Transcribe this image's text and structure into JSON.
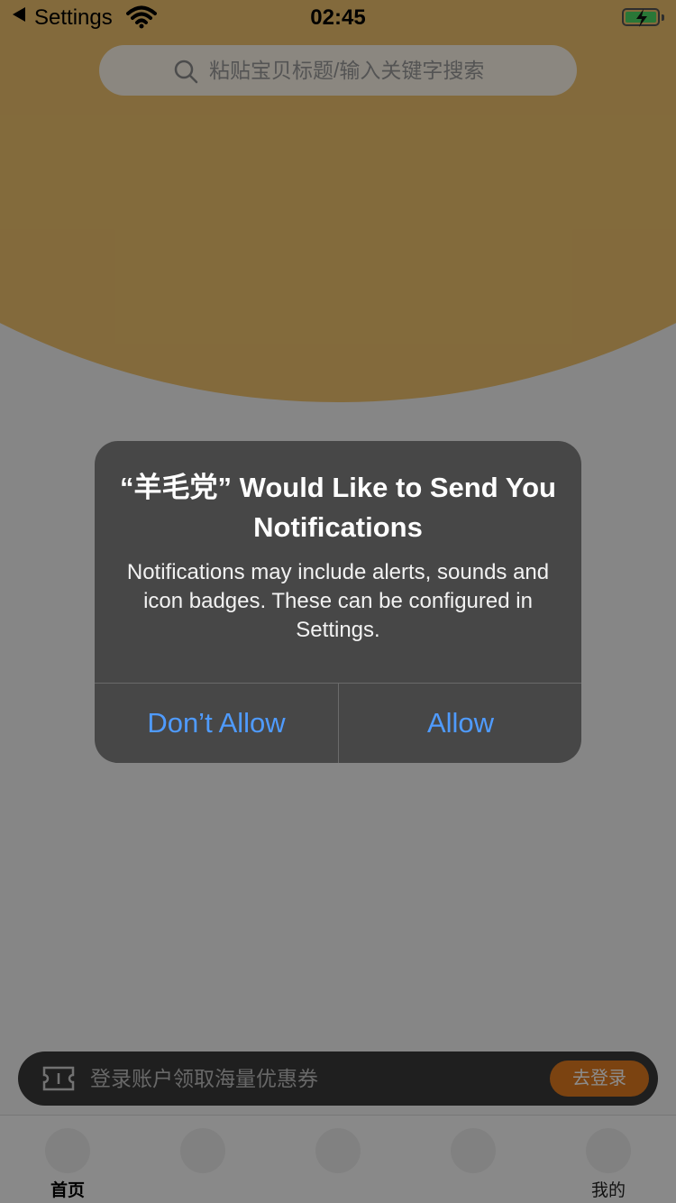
{
  "status_bar": {
    "back_app": "Settings",
    "time": "02:45"
  },
  "search": {
    "placeholder": "粘贴宝贝标题/输入关键字搜索"
  },
  "login_banner": {
    "text": "登录账户领取海量优惠券",
    "button_label": "去登录"
  },
  "tabs": [
    {
      "label": "首页",
      "active": true
    },
    {
      "label": ""
    },
    {
      "label": ""
    },
    {
      "label": ""
    },
    {
      "label": "我的"
    }
  ],
  "alert": {
    "title": "“羊毛党” Would Like to Send You Notifications",
    "message": "Notifications may include alerts, sounds and icon badges. These can be configured in Settings.",
    "buttons": {
      "dont_allow": "Don’t Allow",
      "allow": "Allow"
    }
  },
  "colors": {
    "hero": "#efc26e",
    "accent_button": "#e07a1f",
    "alert_button_text": "#4f9bff",
    "battery_fill": "#4cd964"
  }
}
